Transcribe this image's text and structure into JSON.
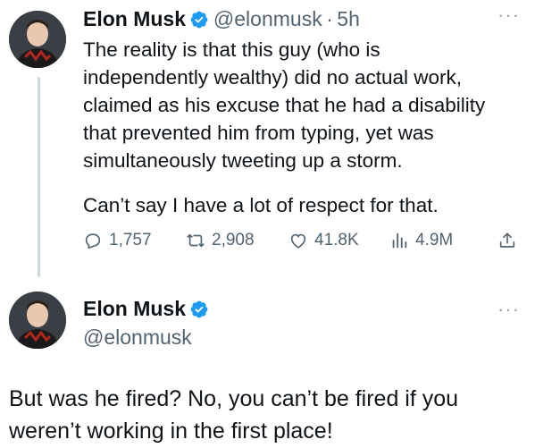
{
  "tweet": {
    "author_name": "Elon Musk",
    "author_handle": "@elonmusk",
    "separator": "·",
    "time": "5h",
    "more": "···",
    "lines": [
      "The reality is that this guy (who is",
      "independently wealthy) did no actual work,",
      "claimed as his excuse that he had a disability",
      "that prevented him from typing, yet was",
      "simultaneously tweeting up a storm."
    ],
    "line2": "Can’t say I have a lot of respect for that.",
    "stats": {
      "replies": "1,757",
      "retweets": "2,908",
      "likes": "41.8K",
      "views": "4.9M"
    }
  },
  "reply": {
    "author_name": "Elon Musk",
    "author_handle": "@elonmusk",
    "more": "···",
    "lines": [
      "But was he fired? No, you can’t be fired if you",
      "weren’t working in the first place!"
    ]
  },
  "colors": {
    "verified": "#1d9bf0",
    "secondary_text": "#536471",
    "thread_line": "#cfd9de"
  },
  "icons": [
    "verified-badge-icon",
    "reply-icon",
    "retweet-icon",
    "like-icon",
    "views-icon",
    "share-icon",
    "more-icon"
  ]
}
